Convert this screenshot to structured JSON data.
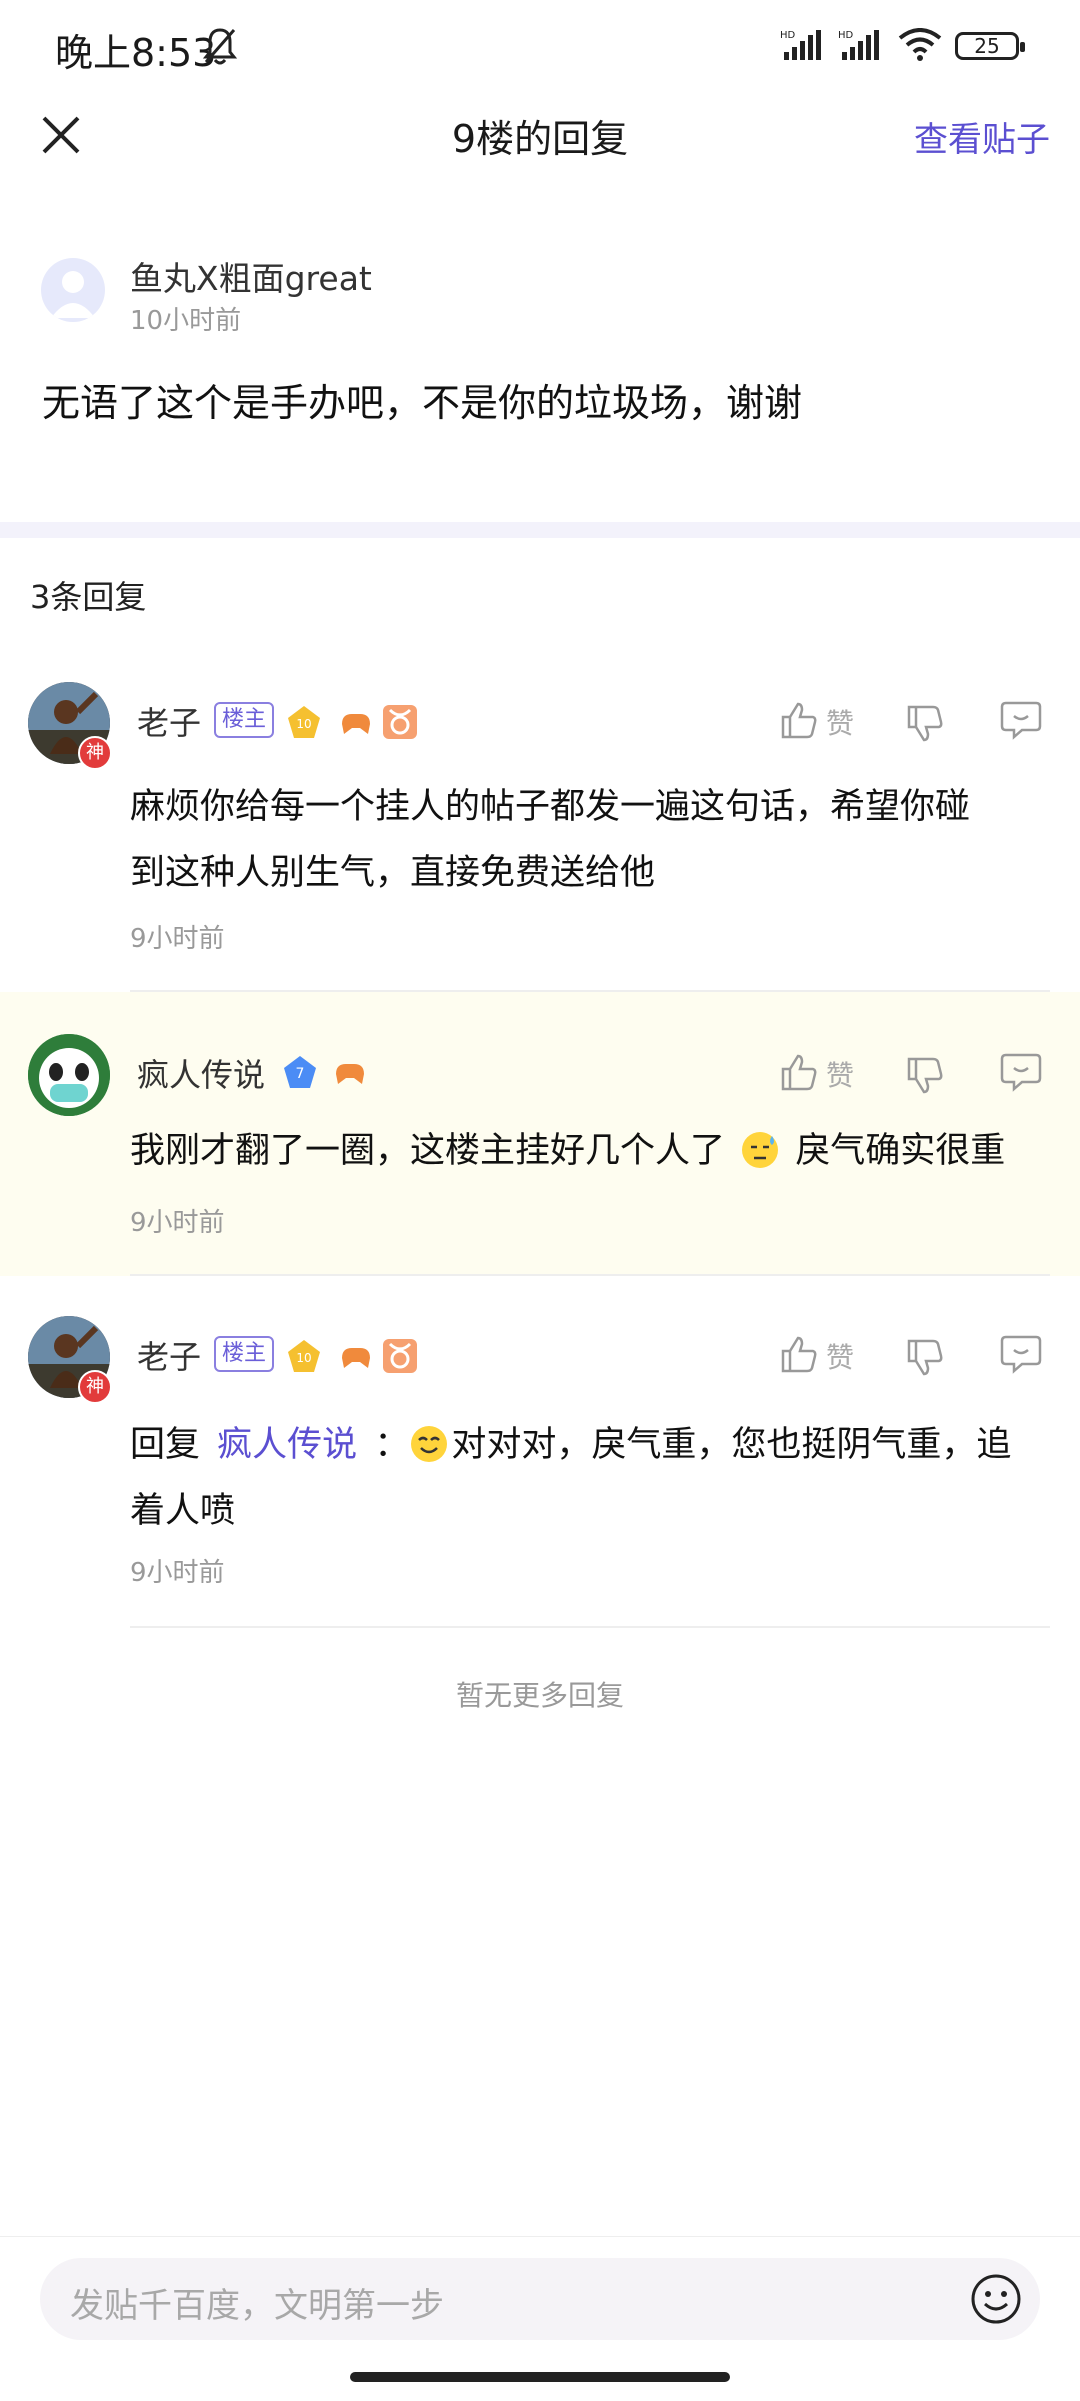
{
  "status": {
    "time": "晚上8:53",
    "battery": "25"
  },
  "nav": {
    "title": "9楼的回复",
    "view_post": "查看贴子"
  },
  "post": {
    "username": "鱼丸X粗面great",
    "time": "10小时前",
    "content": "无语了这个是手办吧，不是你的垃圾场，谢谢"
  },
  "replies_count": "3条回复",
  "replies": [
    {
      "username": "老子",
      "owner_tag": "楼主",
      "level": "10",
      "avatar_badge": "神",
      "like": "赞",
      "line1": "麻烦你给每一个挂人的帖子都发一遍这句话，希望你碰",
      "line2": "到这种人别生气，直接免费送给他",
      "time": "9小时前"
    },
    {
      "username": "疯人传说",
      "level": "7",
      "like": "赞",
      "text_a": "我刚才翻了一圈，这楼主挂好几个人了",
      "text_b": "戾气确实很重",
      "time": "9小时前"
    },
    {
      "username": "老子",
      "owner_tag": "楼主",
      "level": "10",
      "avatar_badge": "神",
      "like": "赞",
      "reply_prefix": "回复",
      "mention": "疯人传说",
      "colon": "：",
      "text_a": "对对对，戾气重，您也挺阴气重，追",
      "line2": "着人喷",
      "time": "9小时前"
    }
  ],
  "no_more": "暂无更多回复",
  "input": {
    "placeholder": "发贴千百度，文明第一步"
  },
  "colors": {
    "accent": "#5b4fd1",
    "highlight_bg": "#fefdf0"
  }
}
